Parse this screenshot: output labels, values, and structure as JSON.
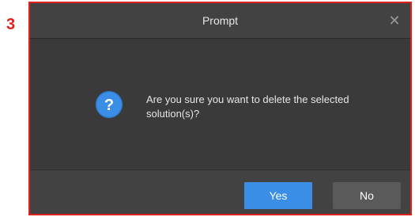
{
  "annotation": {
    "step_number": "3"
  },
  "dialog": {
    "title": "Prompt",
    "close_glyph": "✕",
    "icon": "question-icon",
    "message": "Are you sure you want to delete the selected solution(s)?",
    "buttons": {
      "yes_label": "Yes",
      "no_label": "No"
    }
  },
  "colors": {
    "highlight_border": "#e0201a",
    "primary_button": "#3a8ee6",
    "secondary_button": "#5a5a5a",
    "dialog_background": "#3a3a3a"
  }
}
